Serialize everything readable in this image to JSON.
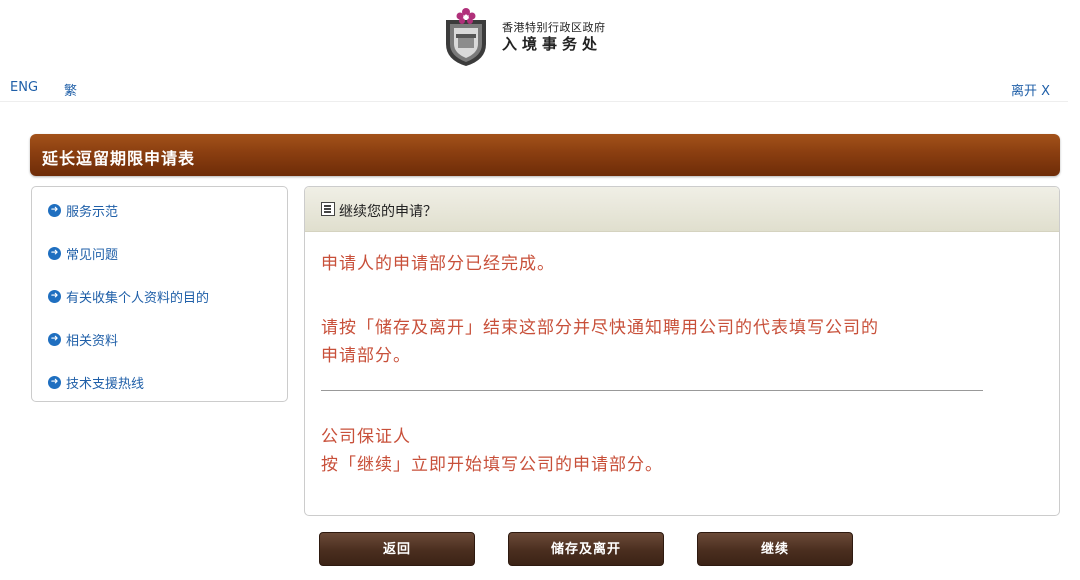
{
  "header": {
    "logo_line1": "香港特别行政区政府",
    "logo_line2": "入境事务处"
  },
  "topbar": {
    "lang_eng": "ENG",
    "lang_trad": "繁",
    "exit": "离开 X"
  },
  "form": {
    "title": "延长逗留期限申请表"
  },
  "sidebar": {
    "items": [
      {
        "label": "服务示范",
        "icon": "arrow-right-circle-icon"
      },
      {
        "label": "常见问题",
        "icon": "arrow-right-circle-icon"
      },
      {
        "label": "有关收集个人资料的目的",
        "icon": "arrow-right-circle-icon"
      },
      {
        "label": "相关资料",
        "icon": "arrow-right-circle-icon"
      },
      {
        "label": "技术支援热线",
        "icon": "arrow-right-circle-icon"
      }
    ]
  },
  "panel": {
    "title": "继续您的申请？",
    "msg1": "申请人的申请部分已经完成。",
    "msg2_line1": "请按「储存及离开」结束这部分并尽快通知聘用公司的代表填写公司的",
    "msg2_line2": "申请部分。",
    "msg3_line1": "公司保证人",
    "msg3_line2": "按「继续」立即开始填写公司的申请部分。"
  },
  "buttons": {
    "back": "返回",
    "save_exit": "储存及离开",
    "continue": "继续"
  },
  "colors": {
    "title_bar": "#8a3e10",
    "link_blue": "#1f5fa8",
    "message_red": "#c8503a",
    "button_brown": "#4a2e1f"
  }
}
